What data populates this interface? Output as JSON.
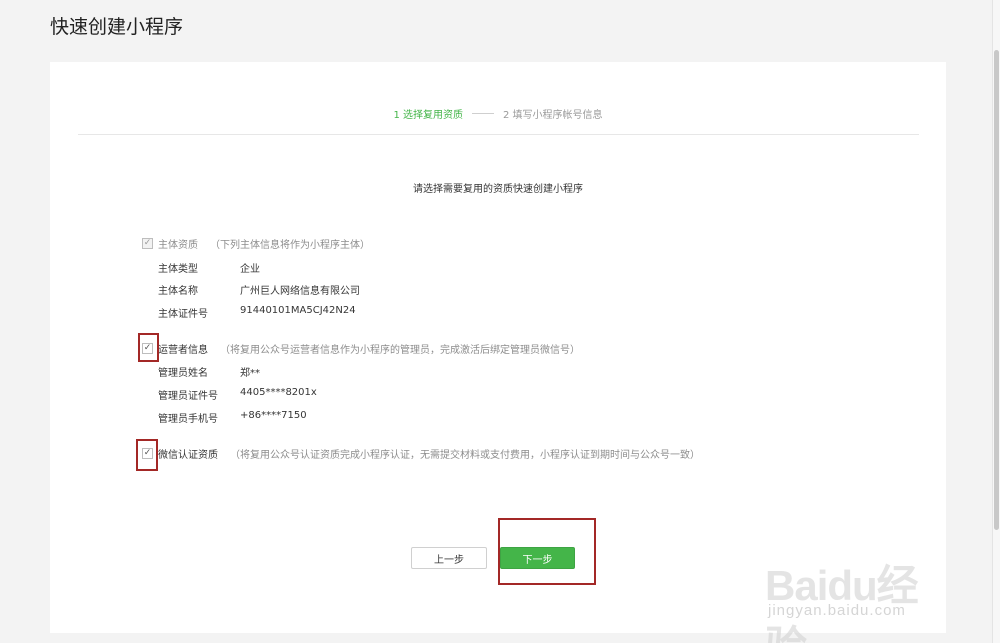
{
  "page": {
    "title": "快速创建小程序"
  },
  "steps": [
    {
      "label": "1 选择复用资质",
      "active": true
    },
    {
      "label": "2 填写小程序帐号信息",
      "active": false
    }
  ],
  "prompt": "请选择需要复用的资质快速创建小程序",
  "sections": {
    "subject": {
      "checked": true,
      "disabled": true,
      "label": "主体资质",
      "note": "（下列主体信息将作为小程序主体）",
      "rows": [
        {
          "key": "主体类型",
          "value": "企业"
        },
        {
          "key": "主体名称",
          "value": "广州巨人网络信息有限公司"
        },
        {
          "key": "主体证件号",
          "value": "91440101MA5CJ42N24"
        }
      ]
    },
    "operator": {
      "checked": true,
      "label": "运营者信息",
      "note": "（将复用公众号运营者信息作为小程序的管理员，完成激活后绑定管理员微信号）",
      "rows": [
        {
          "key": "管理员姓名",
          "value": "郑**"
        },
        {
          "key": "管理员证件号",
          "value": "4405****8201x"
        },
        {
          "key": "管理员手机号",
          "value": "+86****7150"
        }
      ]
    },
    "wechat_cert": {
      "checked": true,
      "label": "微信认证资质",
      "note": "（将复用公众号认证资质完成小程序认证，无需提交材料或支付费用，小程序认证到期时间与公众号一致）"
    }
  },
  "buttons": {
    "prev": "上一步",
    "next": "下一步"
  },
  "colors": {
    "accent": "#44b549",
    "highlight": "#a32826"
  },
  "watermark": {
    "brand": "Baidu经验",
    "site": "jingyan.baidu.com"
  }
}
